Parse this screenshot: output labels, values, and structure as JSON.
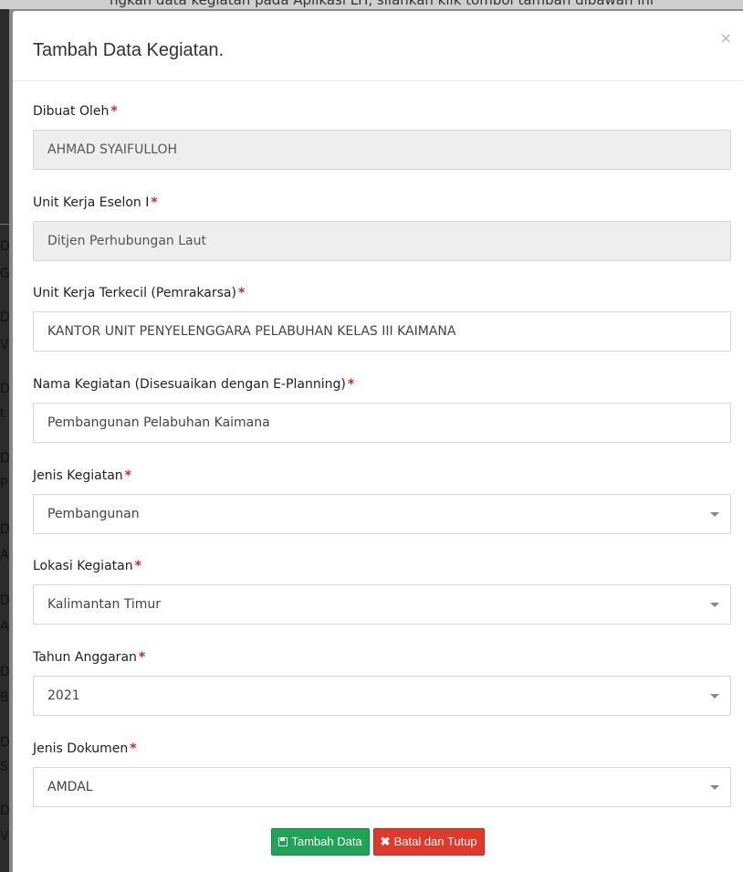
{
  "background": {
    "caption": "ngkan data kegiatan pada Aplikasi LH, silahkan klik tombol tambah dibawah ini",
    "left_letters": [
      "G",
      "D",
      "V",
      "D",
      "t",
      "D",
      "P",
      "D",
      "A",
      "D",
      "A",
      "D",
      "B",
      "D",
      "S",
      "D",
      "V"
    ]
  },
  "modal": {
    "title": "Tambah Data Kegiatan.",
    "close_symbol": "×"
  },
  "required_marker": "*",
  "fields": [
    {
      "label": "Dibuat Oleh",
      "value": "AHMAD SYAIFULLOH",
      "readonly": true,
      "type": "text"
    },
    {
      "label": "Unit Kerja Eselon I",
      "value": "Ditjen Perhubungan Laut",
      "readonly": true,
      "type": "text"
    },
    {
      "label": "Unit Kerja Terkecil (Pemrakarsa)",
      "value": "KANTOR UNIT PENYELENGGARA PELABUHAN KELAS III KAIMANA",
      "readonly": false,
      "type": "text"
    },
    {
      "label": "Nama Kegiatan (Disesuaikan dengan E-Planning)",
      "value": "Pembangunan Pelabuhan Kaimana",
      "readonly": false,
      "type": "text"
    },
    {
      "label": "Jenis Kegiatan",
      "value": "Pembangunan",
      "readonly": false,
      "type": "select"
    },
    {
      "label": "Lokasi Kegiatan",
      "value": "Kalimantan Timur",
      "readonly": false,
      "type": "select"
    },
    {
      "label": "Tahun Anggaran",
      "value": "2021",
      "readonly": false,
      "type": "select"
    },
    {
      "label": "Jenis Dokumen",
      "value": "AMDAL",
      "readonly": false,
      "type": "select"
    }
  ],
  "buttons": {
    "submit_label": "Tambah Data",
    "cancel_label": "Batal dan Tutup",
    "submit_icon": "save-icon",
    "cancel_icon": "close-icon"
  },
  "colors": {
    "success": "#1fa356",
    "danger": "#e0382a",
    "required": "#d9232d",
    "readonly_bg": "#eeeeee"
  }
}
